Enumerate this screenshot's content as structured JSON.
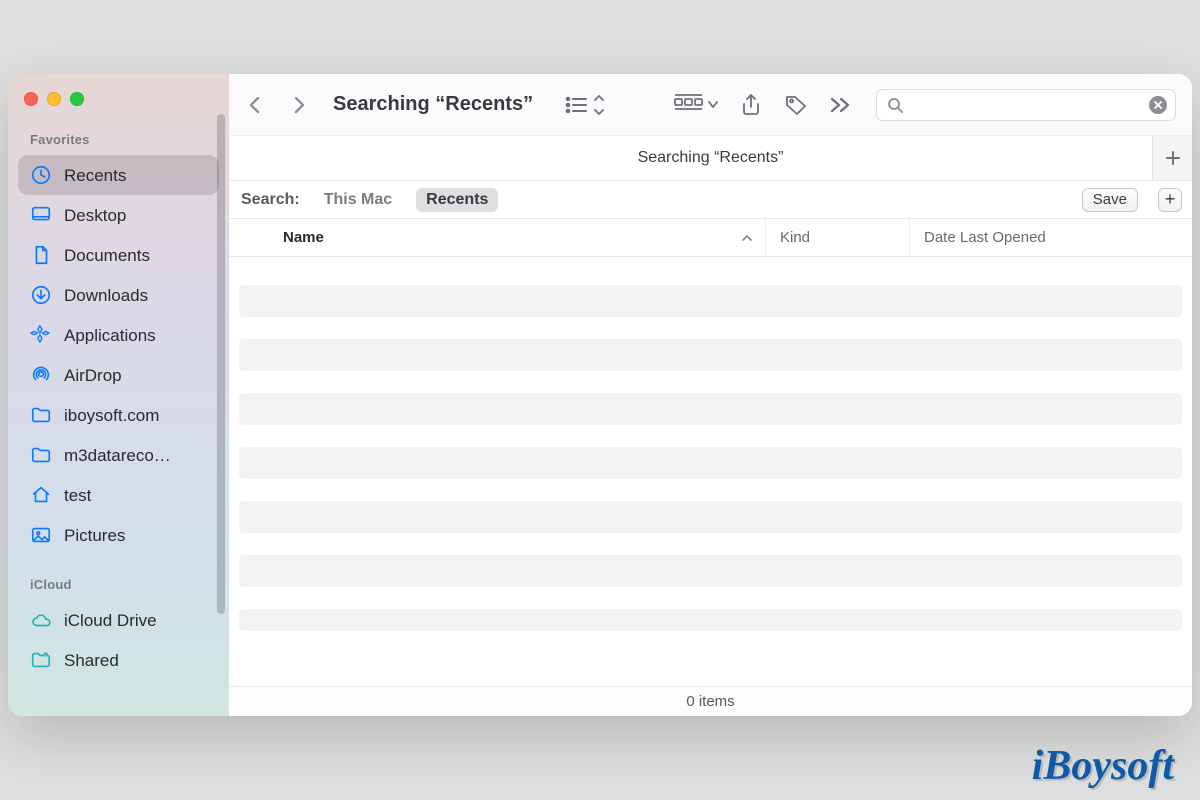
{
  "window": {
    "title": "Searching “Recents”",
    "location_text": "Searching “Recents”"
  },
  "sidebar": {
    "sections": [
      {
        "title": "Favorites",
        "items": [
          {
            "icon": "clock",
            "label": "Recents",
            "selected": true
          },
          {
            "icon": "desktop",
            "label": "Desktop",
            "selected": false
          },
          {
            "icon": "doc",
            "label": "Documents",
            "selected": false
          },
          {
            "icon": "download",
            "label": "Downloads",
            "selected": false
          },
          {
            "icon": "apps",
            "label": "Applications",
            "selected": false
          },
          {
            "icon": "airdrop",
            "label": "AirDrop",
            "selected": false
          },
          {
            "icon": "folder",
            "label": "iboysoft.com",
            "selected": false
          },
          {
            "icon": "folder",
            "label": "m3datareco…",
            "selected": false
          },
          {
            "icon": "house",
            "label": "test",
            "selected": false
          },
          {
            "icon": "picture",
            "label": "Pictures",
            "selected": false
          }
        ]
      },
      {
        "title": "iCloud",
        "items": [
          {
            "icon": "cloud",
            "label": "iCloud Drive",
            "selected": false,
            "teal": true
          },
          {
            "icon": "sharedfolder",
            "label": "Shared",
            "selected": false,
            "teal": true
          }
        ]
      }
    ]
  },
  "toolbar": {
    "view": "list",
    "icons": [
      "list-view",
      "group-by",
      "share",
      "tags",
      "more"
    ]
  },
  "search": {
    "placeholder": "",
    "value": ""
  },
  "scope": {
    "label": "Search:",
    "options": [
      {
        "label": "This Mac",
        "active": false
      },
      {
        "label": "Recents",
        "active": true
      }
    ],
    "save_label": "Save"
  },
  "columns": {
    "name": "Name",
    "kind": "Kind",
    "date_last_opened": "Date Last Opened"
  },
  "status": {
    "item_count_text": "0 items"
  },
  "watermark": "iBoysoft"
}
